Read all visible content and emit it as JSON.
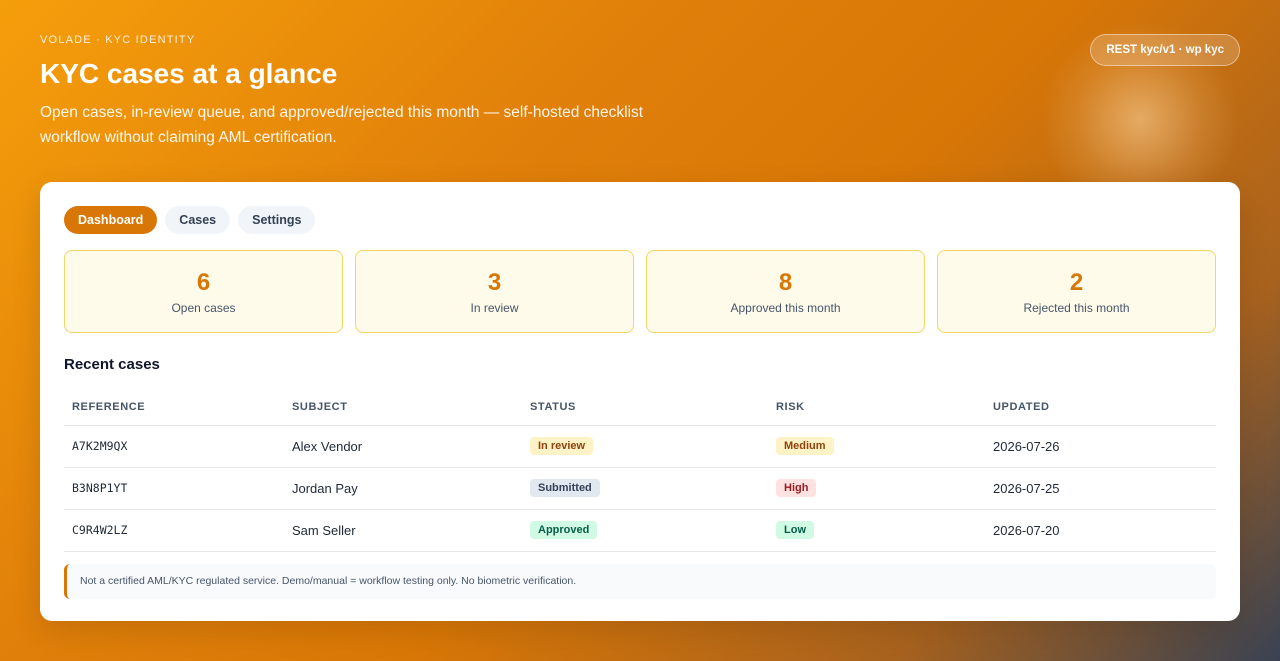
{
  "hero": {
    "eyebrow": "VOLADE · KYC IDENTITY",
    "title": "KYC cases at a glance",
    "subtitle": "Open cases, in-review queue, and approved/rejected this month — self-hosted checklist workflow without claiming AML certification.",
    "api_label": "REST kyc/v1 · wp kyc"
  },
  "tabs": [
    {
      "label": "Dashboard",
      "active": true
    },
    {
      "label": "Cases",
      "active": false
    },
    {
      "label": "Settings",
      "active": false
    }
  ],
  "stats": [
    {
      "value": "6",
      "label": "Open cases"
    },
    {
      "value": "3",
      "label": "In review"
    },
    {
      "value": "8",
      "label": "Approved this month"
    },
    {
      "value": "2",
      "label": "Rejected this month"
    }
  ],
  "recent": {
    "title": "Recent cases",
    "headers": [
      "REFERENCE",
      "SUBJECT",
      "STATUS",
      "RISK",
      "UPDATED"
    ],
    "rows": [
      {
        "reference": "A7K2M9QX",
        "subject": "Alex Vendor",
        "status": "In review",
        "risk": "Medium",
        "updated": "2026-07-26"
      },
      {
        "reference": "B3N8P1YT",
        "subject": "Jordan Pay",
        "status": "Submitted",
        "risk": "High",
        "updated": "2026-07-25"
      },
      {
        "reference": "C9R4W2LZ",
        "subject": "Sam Seller",
        "status": "Approved",
        "risk": "Low",
        "updated": "2026-07-20"
      }
    ]
  },
  "badge_colors": {
    "In review": {
      "bg": "#fef3c7",
      "fg": "#92400e"
    },
    "Submitted": {
      "bg": "#e2e8f0",
      "fg": "#334155"
    },
    "Approved": {
      "bg": "#d1fae5",
      "fg": "#065f46"
    },
    "Medium": {
      "bg": "#fef3c7",
      "fg": "#92400e"
    },
    "High": {
      "bg": "#fee2e2",
      "fg": "#991b1b"
    },
    "Low": {
      "bg": "#d1fae5",
      "fg": "#065f46"
    }
  },
  "note": "Not a certified AML/KYC regulated service. Demo/manual = workflow testing only. No biometric verification.",
  "colors": {
    "accent": "#d97706",
    "stat_border": "#f3d566",
    "stat_bg": "#fefbea"
  }
}
